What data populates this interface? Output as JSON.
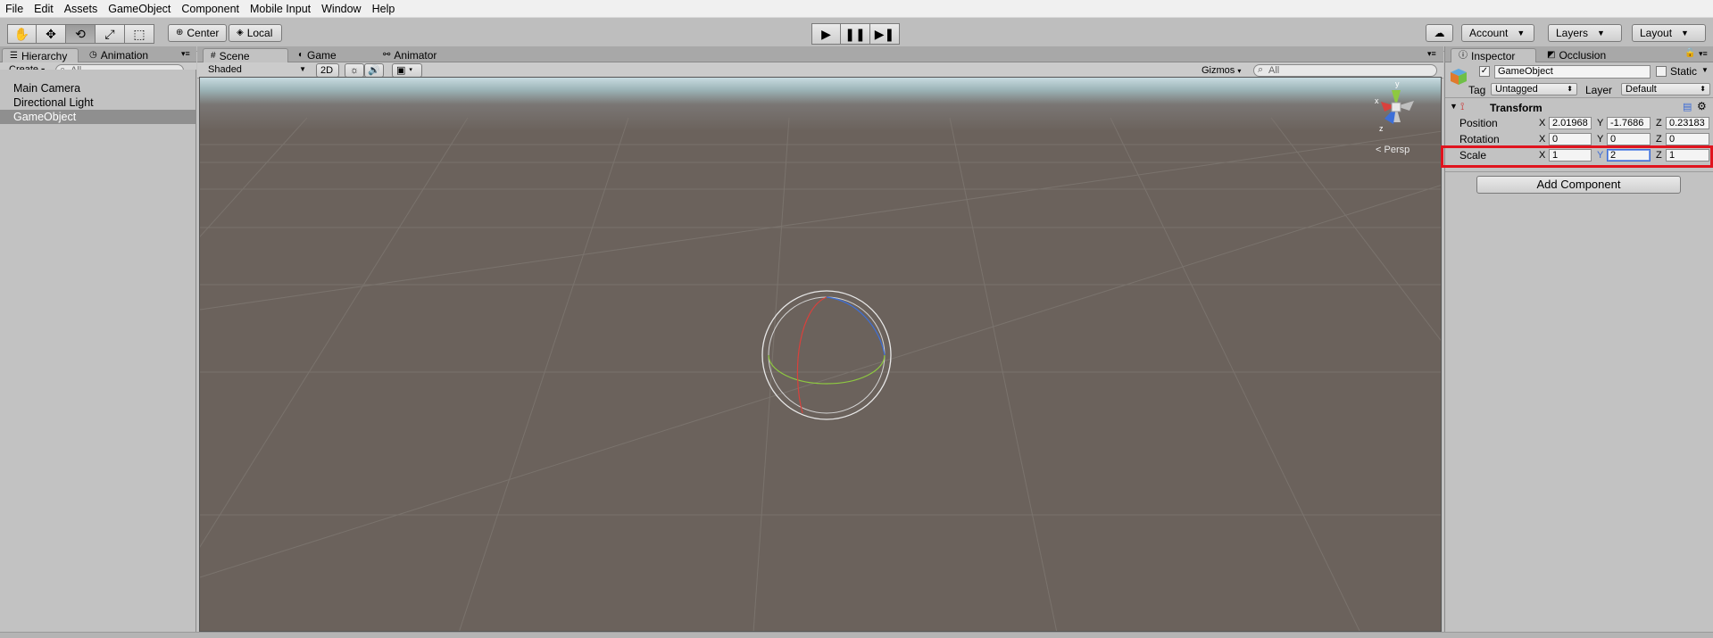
{
  "menubar": {
    "items": [
      "File",
      "Edit",
      "Assets",
      "GameObject",
      "Component",
      "Mobile Input",
      "Window",
      "Help"
    ]
  },
  "toolbar": {
    "tools": [
      "hand-icon",
      "move-icon",
      "rotate-icon",
      "scale-icon",
      "rect-icon"
    ],
    "pivot_center": "Center",
    "pivot_local": "Local",
    "account_label": "Account",
    "layers_label": "Layers",
    "layout_label": "Layout"
  },
  "hierarchy": {
    "tab_label": "Hierarchy",
    "animation_tab_label": "Animation",
    "create_label": "Create",
    "search_placeholder": "All",
    "items": [
      "Main Camera",
      "Directional Light",
      "GameObject"
    ],
    "selected_index": 2
  },
  "scene": {
    "tab_scene": "Scene",
    "tab_game": "Game",
    "tab_animator": "Animator",
    "shading_mode": "Shaded",
    "mode_2d": "2D",
    "gizmos_label": "Gizmos",
    "search_placeholder": "All",
    "projection_label": "Persp",
    "gizmo_axes": {
      "x": "x",
      "y": "y",
      "z": "z"
    }
  },
  "inspector": {
    "tab_inspector": "Inspector",
    "tab_occlusion": "Occlusion",
    "object_name": "GameObject",
    "static_label": "Static",
    "tag_label": "Tag",
    "tag_value": "Untagged",
    "layer_label": "Layer",
    "layer_value": "Default",
    "component_title": "Transform",
    "position_label": "Position",
    "rotation_label": "Rotation",
    "scale_label": "Scale",
    "axis_x": "X",
    "axis_y": "Y",
    "axis_z": "Z",
    "position": {
      "x": "2.01968",
      "y": "-1.7686",
      "z": "0.23183"
    },
    "rotation": {
      "x": "0",
      "y": "0",
      "z": "0"
    },
    "scale": {
      "x": "1",
      "y": "2",
      "z": "1"
    },
    "add_component_label": "Add Component"
  },
  "colors": {
    "highlight_box": "#e0141e",
    "selection_row": "#8f8f8f",
    "focus_field": "#3b6bd6",
    "gizmo_x": "#d9413c",
    "gizmo_y": "#8ec940",
    "gizmo_z": "#3d6fd8"
  }
}
